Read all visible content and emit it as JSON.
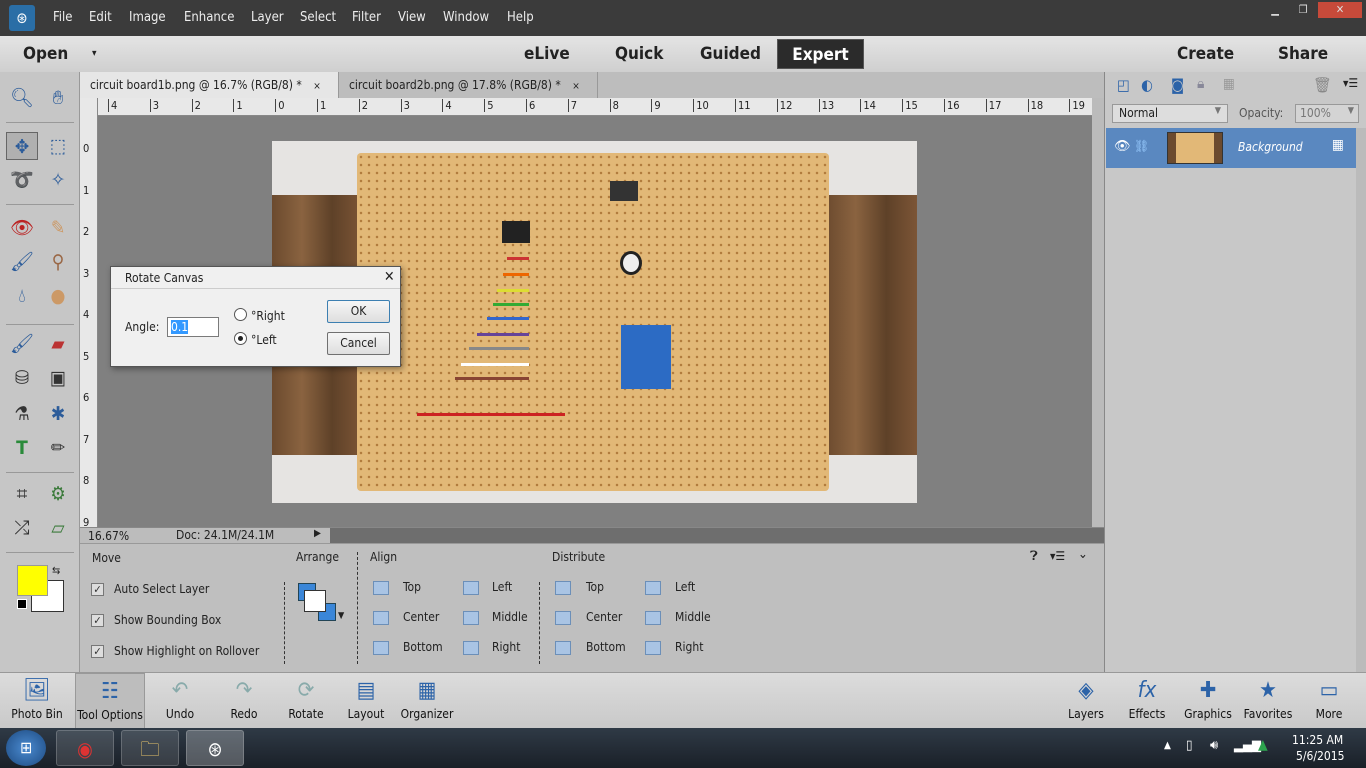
{
  "menubar": {
    "items": [
      "File",
      "Edit",
      "Image",
      "Enhance",
      "Layer",
      "Select",
      "Filter",
      "View",
      "Window",
      "Help"
    ]
  },
  "modebar": {
    "open": "Open",
    "modes": [
      "eLive",
      "Quick",
      "Guided",
      "Expert"
    ],
    "active": "Expert",
    "create": "Create",
    "share": "Share"
  },
  "tabs": [
    {
      "label": "circuit board1b.png @ 16.7% (RGB/8) *",
      "close": "×"
    },
    {
      "label": "circuit board2b.png @ 17.8% (RGB/8) *",
      "close": "×"
    }
  ],
  "ruler": {
    "h": [
      "4",
      "3",
      "2",
      "1",
      "0",
      "1",
      "2",
      "3",
      "4",
      "5",
      "6",
      "7",
      "8",
      "9",
      "10",
      "11",
      "12",
      "13",
      "14",
      "15",
      "16",
      "17",
      "18",
      "19"
    ],
    "v": [
      "0",
      "1",
      "2",
      "3",
      "4",
      "5",
      "6",
      "7",
      "8",
      "9"
    ]
  },
  "status": {
    "zoom": "16.67%",
    "doc": "Doc: 24.1M/24.1M"
  },
  "dialog": {
    "title": "Rotate Canvas",
    "angle_label": "Angle:",
    "angle_value": "0.1",
    "right": "°Right",
    "left": "°Left",
    "selected": "left",
    "ok": "OK",
    "cancel": "Cancel",
    "close": "✕"
  },
  "options": {
    "move": "Move",
    "auto_select": "Auto Select Layer",
    "bounding": "Show Bounding Box",
    "highlight": "Show Highlight on Rollover",
    "arrange": "Arrange",
    "align": "Align",
    "align_items": [
      "Top",
      "Center",
      "Bottom",
      "Left",
      "Middle",
      "Right"
    ],
    "distribute": "Distribute",
    "distribute_items": [
      "Top",
      "Center",
      "Bottom",
      "Left",
      "Middle",
      "Right"
    ]
  },
  "layers": {
    "blend": "Normal",
    "opacity_label": "Opacity:",
    "opacity": "100%",
    "layer_name": "Background"
  },
  "bottombar": {
    "left": [
      "Photo Bin",
      "Tool Options",
      "Undo",
      "Redo",
      "Rotate",
      "Layout",
      "Organizer"
    ],
    "right": [
      "Layers",
      "Effects",
      "Graphics",
      "Favorites",
      "More"
    ]
  },
  "taskbar": {
    "time": "11:25 AM",
    "date": "5/6/2015"
  },
  "colors": {
    "foreground": "#ffff00",
    "background": "#ffffff",
    "accent": "#5a88c0"
  }
}
